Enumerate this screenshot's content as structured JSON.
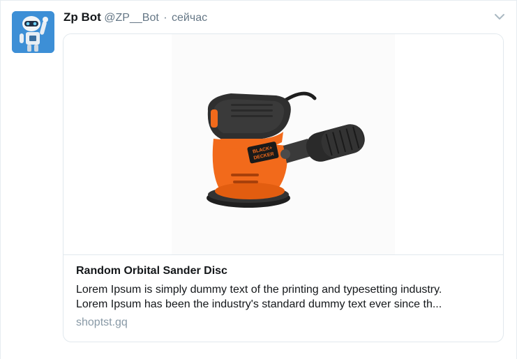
{
  "tweet": {
    "author_name": "Zp Bot",
    "author_handle": "@ZP__Bot",
    "separator": "·",
    "timestamp": "сейчас",
    "avatar_icon": "robot-avatar-icon",
    "menu_icon": "chevron-down-icon"
  },
  "card": {
    "image_icon": "orbital-sander-image",
    "brand_text": "BLACK+DECKER",
    "title": "Random Orbital Sander Disc",
    "description_line1": "Lorem Ipsum is simply dummy text of the printing and typesetting industry.",
    "description_line2": "Lorem Ipsum has been the industry's standard dummy text ever since th...",
    "domain": "shoptst.gq"
  },
  "colors": {
    "accent_blue": "#3d8fd6",
    "sander_orange": "#f26a1b",
    "sander_dark": "#2f2f2f",
    "text_secondary": "#657786",
    "border": "#e1e8ed"
  }
}
